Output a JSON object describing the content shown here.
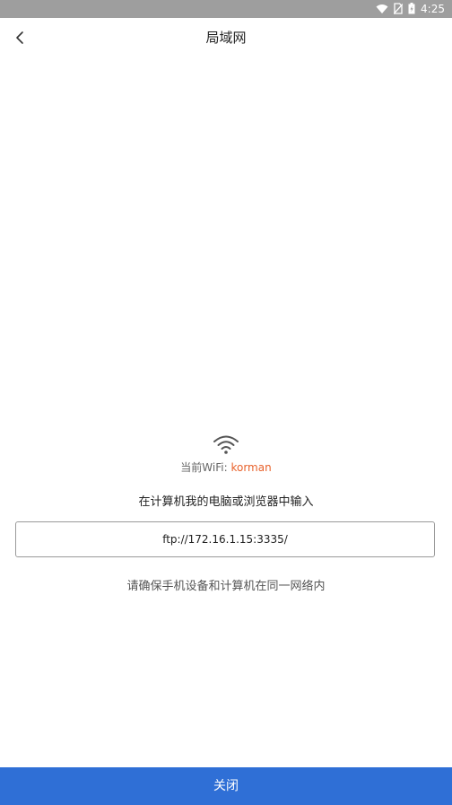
{
  "status_bar": {
    "time": "4:25",
    "icons": [
      "wifi-icon",
      "no-sim-icon",
      "battery-icon"
    ]
  },
  "header": {
    "title": "局域网",
    "back_icon": "chevron-left-icon"
  },
  "wifi": {
    "icon": "wifi-icon",
    "label": "当前WiFi: ",
    "name": "korman",
    "name_color": "#e8622c"
  },
  "instruction": "在计算机我的电脑或浏览器中输入",
  "address": "ftp://172.16.1.15:3335/",
  "hint": "请确保手机设备和计算机在同一网络内",
  "footer": {
    "close_label": "关闭",
    "button_color": "#2f6fd6"
  }
}
